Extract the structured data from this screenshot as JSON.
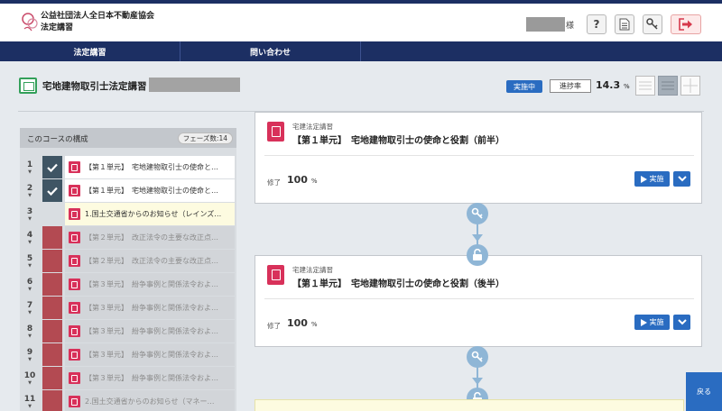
{
  "header": {
    "org_name": "公益社団法人全日本不動産協会",
    "site_name": "法定講習",
    "user_suffix": "様",
    "icons": [
      "help-icon",
      "document-icon",
      "key-icon",
      "logout-icon"
    ]
  },
  "nav": {
    "items": [
      {
        "label": "法定講習"
      },
      {
        "label": "問い合わせ"
      }
    ]
  },
  "course": {
    "title": "宅地建物取引士法定講習",
    "status_badge": "実施中",
    "progress_label": "進捗率",
    "progress_value": "14.3",
    "progress_unit": "%"
  },
  "sidebar": {
    "heading": "このコースの構成",
    "phase_count": "フェーズ数:14",
    "rows": [
      {
        "num": "1",
        "status": "done",
        "text": "【第１単元】　宅地建物取引士の使命と…"
      },
      {
        "num": "2",
        "status": "done",
        "text": "【第１単元】　宅地建物取引士の使命と…"
      },
      {
        "num": "3",
        "status": "current",
        "text": "1.国土交通省からのお知らせ（レインズ…"
      },
      {
        "num": "4",
        "status": "locked",
        "text": "【第２単元】　改正法令の主要な改正点…"
      },
      {
        "num": "5",
        "status": "locked",
        "text": "【第２単元】　改正法令の主要な改正点…"
      },
      {
        "num": "6",
        "status": "locked",
        "text": "【第３単元】　紛争事例と関係法令およ…"
      },
      {
        "num": "7",
        "status": "locked",
        "text": "【第３単元】　紛争事例と関係法令およ…"
      },
      {
        "num": "8",
        "status": "locked",
        "text": "【第３単元】　紛争事例と関係法令およ…"
      },
      {
        "num": "9",
        "status": "locked",
        "text": "【第３単元】　紛争事例と関係法令およ…"
      },
      {
        "num": "10",
        "status": "locked",
        "text": "【第３単元】　紛争事例と関係法令およ…"
      },
      {
        "num": "11",
        "status": "locked",
        "text": "2.国土交通省からのお知らせ（マネー…"
      }
    ]
  },
  "cards": [
    {
      "subtitle": "宅建法定講習",
      "title": "【第１単元】　宅地建物取引士の使命と役割（前半）",
      "done_label": "修了",
      "done_value": "100",
      "done_unit": "%",
      "run_label": "実施"
    },
    {
      "subtitle": "宅建法定講習",
      "title": "【第１単元】　宅地建物取引士の使命と役割（後半）",
      "done_label": "修了",
      "done_value": "100",
      "done_unit": "%",
      "run_label": "実施"
    }
  ],
  "back_label": "戻る",
  "colors": {
    "navy": "#1c2f63",
    "accent_blue": "#2a6cc1",
    "done_status": "#3f5564",
    "locked_status": "#b34a52",
    "content_icon": "#d8315a",
    "connector": "#8fb6d6"
  }
}
